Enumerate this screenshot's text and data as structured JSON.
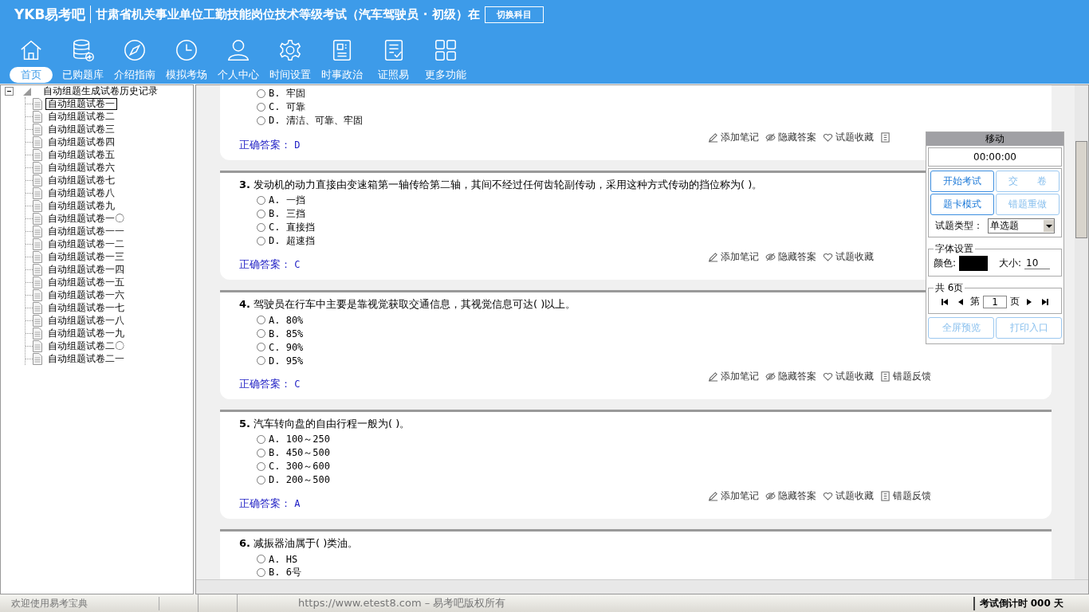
{
  "header": {
    "logo": "YKB易考吧",
    "title": "甘肃省机关事业单位工勤技能岗位技术等级考试（汽车驾驶员 · 初级）在",
    "switch_button": "切换科目"
  },
  "nav": [
    {
      "label": "首页",
      "selected": true
    },
    {
      "label": "已购题库",
      "selected": false
    },
    {
      "label": "介绍指南",
      "selected": false
    },
    {
      "label": "模拟考场",
      "selected": false
    },
    {
      "label": "个人中心",
      "selected": false
    },
    {
      "label": "时间设置",
      "selected": false
    },
    {
      "label": "时事政治",
      "selected": false
    },
    {
      "label": "证照易",
      "selected": false
    },
    {
      "label": "更多功能",
      "selected": false
    }
  ],
  "tree": {
    "root": "自动组题生成试卷历史记录",
    "expanded": true,
    "children": [
      {
        "label": "自动组题试卷一",
        "selected": true
      },
      {
        "label": "自动组题试卷二",
        "selected": false
      },
      {
        "label": "自动组题试卷三",
        "selected": false
      },
      {
        "label": "自动组题试卷四",
        "selected": false
      },
      {
        "label": "自动组题试卷五",
        "selected": false
      },
      {
        "label": "自动组题试卷六",
        "selected": false
      },
      {
        "label": "自动组题试卷七",
        "selected": false
      },
      {
        "label": "自动组题试卷八",
        "selected": false
      },
      {
        "label": "自动组题试卷九",
        "selected": false
      },
      {
        "label": "自动组题试卷一〇",
        "selected": false
      },
      {
        "label": "自动组题试卷一一",
        "selected": false
      },
      {
        "label": "自动组题试卷一二",
        "selected": false
      },
      {
        "label": "自动组题试卷一三",
        "selected": false
      },
      {
        "label": "自动组题试卷一四",
        "selected": false
      },
      {
        "label": "自动组题试卷一五",
        "selected": false
      },
      {
        "label": "自动组题试卷一六",
        "selected": false
      },
      {
        "label": "自动组题试卷一七",
        "selected": false
      },
      {
        "label": "自动组题试卷一八",
        "selected": false
      },
      {
        "label": "自动组题试卷一九",
        "selected": false
      },
      {
        "label": "自动组题试卷二〇",
        "selected": false
      },
      {
        "label": "自动组题试卷二一",
        "selected": false
      }
    ]
  },
  "questions": [
    {
      "options": [
        {
          "label": "B. 牢固",
          "selected": false
        },
        {
          "label": "C. 可靠",
          "selected": false
        },
        {
          "label": "D. 清洁、可靠、牢固",
          "selected": false
        }
      ],
      "actions": [
        {
          "kind": "note",
          "label": "添加笔记"
        },
        {
          "kind": "hide",
          "label": "隐藏答案"
        },
        {
          "kind": "favorite",
          "label": "试题收藏"
        },
        {
          "kind": "feedback"
        }
      ],
      "answer_label": "正确答案：",
      "answer": "D"
    },
    {
      "number": "3.",
      "text": "发动机的动力直接由变速箱第一轴传给第二轴，其间不经过任何齿轮副传动，采用这种方式传动的挡位称为( )。",
      "options": [
        {
          "label": "A. 一挡",
          "selected": false
        },
        {
          "label": "B. 三挡",
          "selected": false
        },
        {
          "label": "C. 直接挡",
          "selected": false
        },
        {
          "label": "D. 超速挡",
          "selected": false
        }
      ],
      "actions": [
        {
          "kind": "note",
          "label": "添加笔记"
        },
        {
          "kind": "hide",
          "label": "隐藏答案"
        },
        {
          "kind": "favorite",
          "label": "试题收藏"
        }
      ],
      "answer_label": "正确答案：",
      "answer": "C"
    },
    {
      "number": "4.",
      "text": "驾驶员在行车中主要是靠视觉获取交通信息，其视觉信息可达( )以上。",
      "options": [
        {
          "label": "A. 80%",
          "selected": false
        },
        {
          "label": "B. 85%",
          "selected": false
        },
        {
          "label": "C. 90%",
          "selected": false
        },
        {
          "label": "D. 95%",
          "selected": false
        }
      ],
      "actions": [
        {
          "kind": "note",
          "label": "添加笔记"
        },
        {
          "kind": "hide",
          "label": "隐藏答案"
        },
        {
          "kind": "favorite",
          "label": "试题收藏"
        },
        {
          "kind": "feedback",
          "label": "错题反馈"
        }
      ],
      "answer_label": "正确答案：",
      "answer": "C"
    },
    {
      "number": "5.",
      "text": "汽车转向盘的自由行程一般为( )。",
      "options": [
        {
          "label": "A. 100～250",
          "selected": false
        },
        {
          "label": "B. 450～500",
          "selected": false
        },
        {
          "label": "C. 300～600",
          "selected": false
        },
        {
          "label": "D. 200～500",
          "selected": false
        }
      ],
      "actions": [
        {
          "kind": "note",
          "label": "添加笔记"
        },
        {
          "kind": "hide",
          "label": "隐藏答案"
        },
        {
          "kind": "favorite",
          "label": "试题收藏"
        },
        {
          "kind": "feedback",
          "label": "错题反馈"
        }
      ],
      "answer_label": "正确答案：",
      "answer": "A"
    },
    {
      "number": "6.",
      "text": "减振器油属于( )类油。",
      "options": [
        {
          "label": "A. HS",
          "selected": false
        },
        {
          "label": "B. 6号",
          "selected": false
        }
      ]
    }
  ],
  "panel": {
    "title": "移动",
    "timer": "00:00:00",
    "buttons": [
      {
        "label": "开始考试",
        "disabled": false
      },
      {
        "label": "交　　卷",
        "disabled": true
      },
      {
        "label": "题卡模式",
        "disabled": false
      },
      {
        "label": "错题重做",
        "disabled": true
      }
    ],
    "type_label": "试题类型：",
    "type_value": "单选题",
    "font": {
      "legend": "字体设置",
      "color_label": "颜色:",
      "color": "#000000",
      "size_label": "大小:",
      "size": "10"
    },
    "pages": {
      "legend": "共 6页",
      "prefix": "第",
      "page": "1",
      "suffix": "页"
    },
    "bottom_buttons": [
      {
        "label": "全屏预览",
        "disabled": true
      },
      {
        "label": "打印入口",
        "disabled": true
      }
    ]
  },
  "status_bar": {
    "welcome": "欢迎使用易考宝典",
    "copyright": "https://www.etest8.com – 易考吧版权所有",
    "countdown": "考试倒计时 000 天"
  }
}
